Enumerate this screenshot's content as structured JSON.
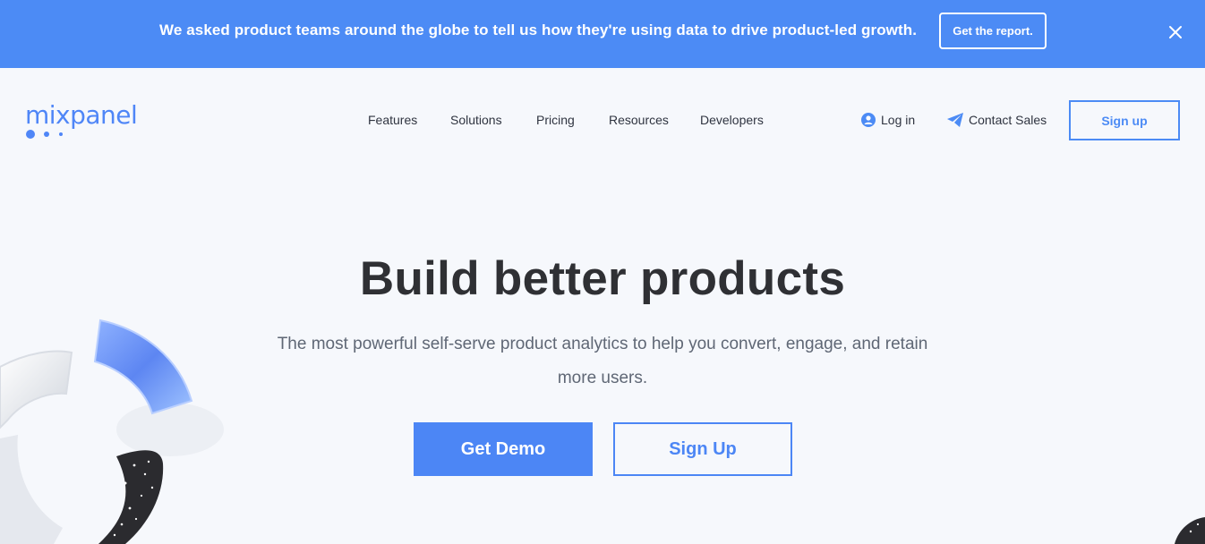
{
  "banner": {
    "text": "We asked product teams around the globe to tell us how they're using data to drive product-led growth.",
    "button_label": "Get the report.",
    "close_icon": "close-icon"
  },
  "header": {
    "logo_text": "mixpanel",
    "nav": [
      {
        "label": "Features"
      },
      {
        "label": "Solutions"
      },
      {
        "label": "Pricing"
      },
      {
        "label": "Resources"
      },
      {
        "label": "Developers"
      }
    ],
    "login_label": "Log in",
    "contact_label": "Contact Sales",
    "signup_label": "Sign up"
  },
  "hero": {
    "title": "Build better products",
    "subtitle_line1": "The most powerful self-serve product analytics to help you convert, engage, and retain",
    "subtitle_line2": "more users.",
    "demo_label": "Get Demo",
    "signup_label": "Sign Up"
  },
  "colors": {
    "accent": "#4c8bf5",
    "background": "#f6f8fc",
    "text": "#2f3440"
  }
}
